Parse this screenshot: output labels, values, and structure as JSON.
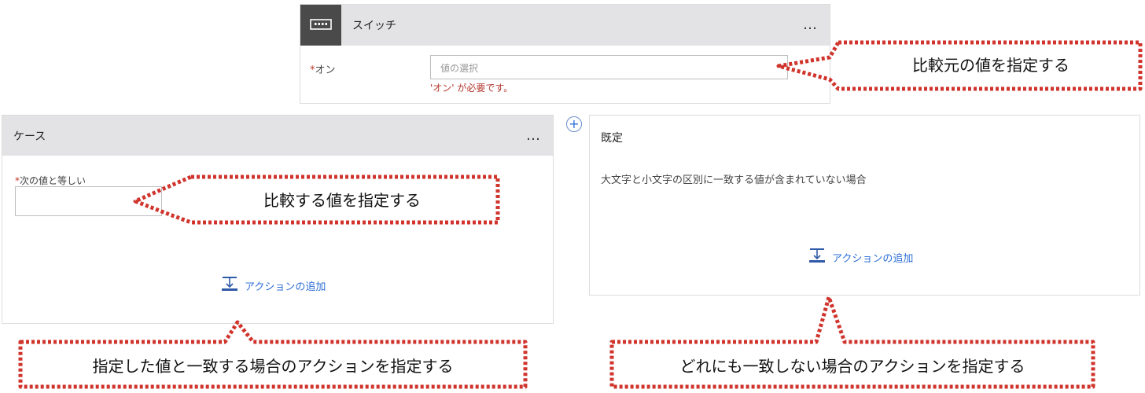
{
  "switch_card": {
    "title": "スイッチ",
    "more": "…",
    "on_label": "オン",
    "required_mark": "*",
    "value_placeholder": "値の選択",
    "error": "'オン' が必要です。"
  },
  "case_card": {
    "title": "ケース",
    "more": "…",
    "equals_label": "次の値と等しい",
    "required_mark": "*",
    "add_action": "アクションの追加"
  },
  "default_card": {
    "title": "既定",
    "description": "大文字と小文字の区別に一致する値が含まれていない場合",
    "add_action": "アクションの追加"
  },
  "add_branch": "+",
  "callouts": {
    "switch_value": "比較元の値を指定する",
    "case_value": "比較する値を指定する",
    "case_action": "指定した値と一致する場合のアクションを指定する",
    "default_action": "どれにも一致しない場合のアクションを指定する"
  },
  "colors": {
    "callout_border": "#d0342c",
    "link": "#2f6fd6",
    "header_bg": "#e3e3e5",
    "error": "#b5392f"
  }
}
